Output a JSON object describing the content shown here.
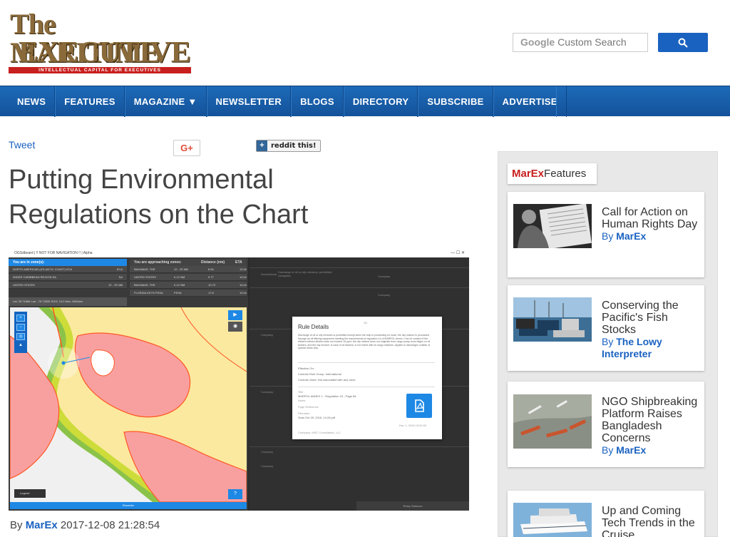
{
  "site": {
    "logo_line1": "The MARITIME",
    "logo_line2": "EXECUTIVE",
    "logo_tagline": "INTELLECTUAL CAPITAL FOR EXECUTIVES",
    "search_placeholder_brand": "Google",
    "search_placeholder": "Custom Search"
  },
  "nav": {
    "items": [
      "NEWS",
      "FEATURES",
      "MAGAZINE ▼",
      "NEWSLETTER",
      "BLOGS",
      "DIRECTORY",
      "SUBSCRIBE",
      "ADVERTISE"
    ]
  },
  "social": {
    "tweet": "Tweet",
    "gplus": "G+",
    "reddit": "reddit this!"
  },
  "article": {
    "title": "Putting Environmental Regulations on the Chart",
    "by_label": "By",
    "author": "MarEx",
    "datetime": "2017-12-08 21:28:54"
  },
  "shot": {
    "window_title": "OGSdboard | !! NOT FOR NAVIGATION !! | Alpha",
    "zone_header": "You are in zone(s):",
    "approach_header": "You are approaching zones:",
    "approach_cols": [
      "Distance (nm)",
      "ETA"
    ],
    "zones": [
      {
        "name": "NORTH AMERICAN (ATLANTIC COAST) ECA",
        "code": "ECA"
      },
      {
        "name": "WIDER CARIBBEAN REGION SA",
        "code": "SA"
      },
      {
        "name": "UNITED STATES",
        "code": "12 - 25 NM"
      }
    ],
    "approaching": [
      {
        "name": "BAHAMAS, THE",
        "range": "12 - 25 NM",
        "dist": "8.64",
        "eta": "10:40"
      },
      {
        "name": "UNITED STATES",
        "range": "0-12 NM",
        "dist": "9.77",
        "eta": "10:44"
      },
      {
        "name": "BAHAMAS, THE",
        "range": "0-12 NM",
        "dist": "10.73",
        "eta": "10:44"
      },
      {
        "name": "FLORIDA KEYS PSSA",
        "range": "PSSA",
        "dist": "17.8",
        "eta": "10:44"
      }
    ],
    "coords": "Lat: 25.71666   Lon: -79.72626   SOG: 14.0   Nav: 24M/sec",
    "legend": "Legend",
    "recenter": "Recenter",
    "relay": "Relay Statuses",
    "right_label": "International",
    "right_desc": "Discharge of oil or oily mixtures, prohibited, navigation",
    "company_label": "Company",
    "modal": {
      "title": "Rule Details",
      "oil": "Oil",
      "body": "Discharge of oil or oily mixtures is prohibited except when the ship is proceeding en route; the oily mixture is processed through an oil filtering equipment meeting the requirements of regulation 14 of MARPOL Annex I; the oil content of the effluent without dilution does not exceed 15 ppm; the oily mixture does not originate from cargo pump-room bilges on oil tankers; and the oily mixture, in case of oil tankers, is not mixed with oil cargo residues. Applies to discharges outside of special areas only.",
      "effective": "Effective On:",
      "group": "Controls Rule Group: International",
      "valve": "Controls Valve: Not associated with any valve",
      "doc_title_label": "Title",
      "doc_title": "MARPOL ANNEX 1 - Regulation 15 - Page 66",
      "notes": "Notes",
      "page_ref": "Page Reference",
      "filename_label": "Filename",
      "filename": "Scan Oct 29, 2016, 14:15.pdf",
      "date": "Dec 1, 2016 15:52:00",
      "company": "Company: MSC Consultants, LLC"
    }
  },
  "sidebar": {
    "tab_brand": "MarEx",
    "tab_label": "Features",
    "cards": [
      {
        "title": "Call for Action on Human Rights Day",
        "by": "By",
        "author": "MarEx"
      },
      {
        "title": "Conserving the Pacific's Fish Stocks",
        "by": "By",
        "author": "The Lowy Interpreter"
      },
      {
        "title": "NGO Shipbreaking Platform Raises Bangladesh Concerns",
        "by": "By",
        "author": "MarEx"
      },
      {
        "title": "Up and Coming Tech Trends in the Cruise",
        "by": "By",
        "author": "MarEx"
      }
    ]
  },
  "colors": {
    "nav_blue": "#1a62c0",
    "brand_red": "#c8201e",
    "logo_brown": "#8a6a3a",
    "link_blue": "#1a62c0"
  }
}
